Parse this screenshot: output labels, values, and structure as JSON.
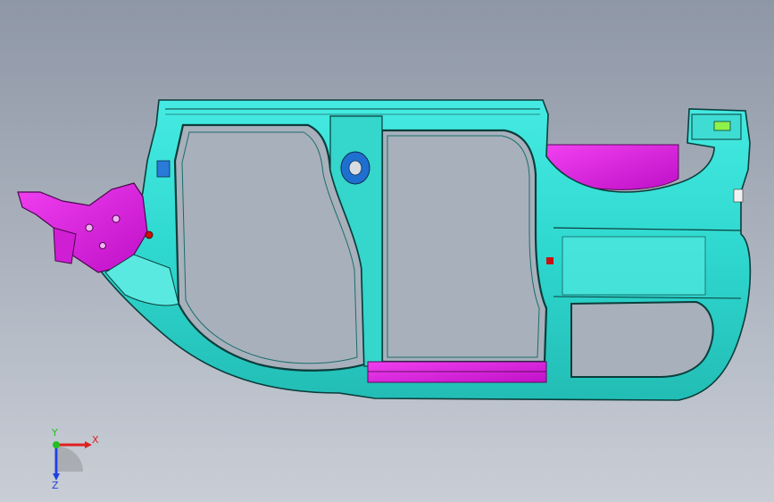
{
  "viewport": {
    "background_top": "#8e97a6",
    "background_bottom": "#c9ced6"
  },
  "model": {
    "primary_color": "#2fe0d6",
    "edge_color": "#0b3d3b",
    "accent_color": "#e020e0"
  },
  "triad": {
    "x_label": "X",
    "y_label": "Y",
    "z_label": "Z",
    "x_color": "#e02020",
    "y_color": "#20c020",
    "z_color": "#2040e0"
  }
}
